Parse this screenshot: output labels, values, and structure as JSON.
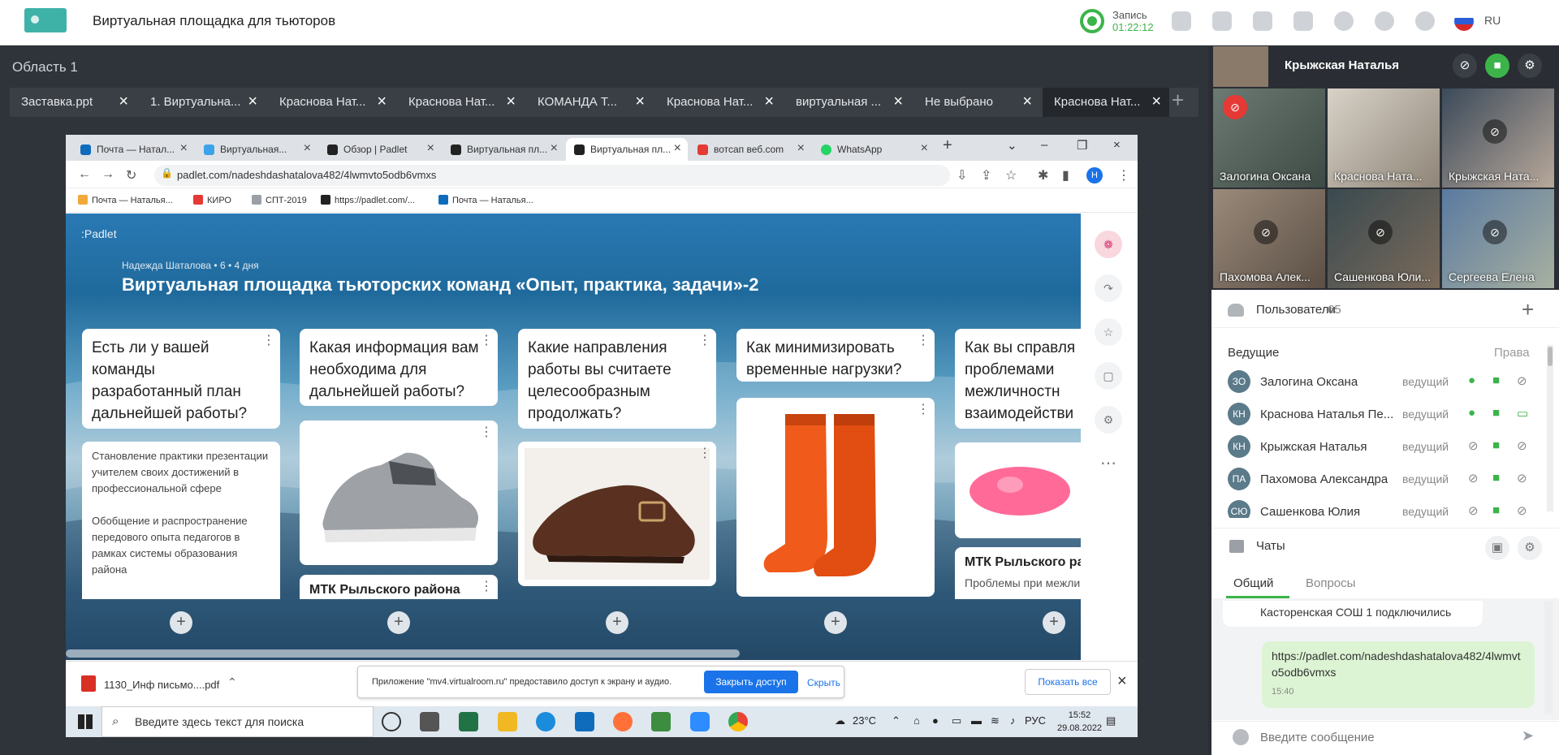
{
  "app": {
    "title": "Виртуальная площадка для тьюторов",
    "record_label": "Запись",
    "record_time": "01:22:12",
    "language": "RU"
  },
  "area_title": "Область 1",
  "doc_tabs": [
    "Заставка.ppt",
    "1. Виртуальна...",
    "Краснова Нат...",
    "Краснова Нат...",
    "КОМАНДА Т...",
    "Краснова Нат...",
    "виртуальная ...",
    "Не выбрано",
    "Краснова Нат..."
  ],
  "browser": {
    "tabs": [
      "Почта — Натал...",
      "Виртуальная...",
      "Обзор | Padlet",
      "Виртуальная пл...",
      "Виртуальная пл...",
      "вотсап веб.com",
      "WhatsApp"
    ],
    "url": "padlet.com/nadeshdashatalova482/4lwmvto5odb6vmxs",
    "bookmarks": [
      "Почта — Наталья...",
      "КИРО",
      "СПТ-2019",
      "https://padlet.com/...",
      "Почта — Наталья..."
    ],
    "profile_letter": "H"
  },
  "padlet": {
    "logo": ":Padlet",
    "meta": "Надежда Шаталова • 6 • 4 дня",
    "title": "Виртуальная площадка тьюторских команд «Опыт, практика, задачи»-2",
    "columns": [
      {
        "question": "Есть ли у вашей команды разработанный план дальнейшей работы?",
        "body": "Становление практики презентации учителем своих достижений в профессиональной сфере\n\nОбобщение и распространение передового опыта педагогов в рамках системы образования района"
      },
      {
        "question": "Какая информация вам необходима для дальнейшей работы?",
        "sub": "МТК Рыльского района"
      },
      {
        "question": "Какие направления работы вы считаете целесообразным продолжать?"
      },
      {
        "question": "Как минимизировать временные нагрузки?"
      },
      {
        "question": "Как вы справля проблемами межличностн взаимодействи",
        "sub": "МТК Рыльского ра",
        "sub_text": "Проблемы при межли"
      }
    ]
  },
  "download": {
    "file": "1130_Инф письмо....pdf",
    "share_text": "Приложение \"mv4.virtualroom.ru\" предоставило доступ к экрану и аудио.",
    "stop_label": "Закрыть доступ",
    "hide_label": "Скрыть",
    "show_all": "Показать все"
  },
  "taskbar": {
    "search_placeholder": "Введите здесь текст для поиска",
    "weather": "23°C",
    "lang": "РУС",
    "time": "15:52",
    "date": "29.08.2022"
  },
  "self_name": "Крыжская Наталья",
  "video_tiles": [
    "Залогина Оксана",
    "Краснова Ната...",
    "Крыжская Ната...",
    "Пахомова Алек...",
    "Сашенкова Юли...",
    "Сергеева Елена"
  ],
  "users": {
    "title": "Пользователи",
    "count": "65",
    "lead_label": "Ведущие",
    "rights_label": "Права",
    "list": [
      {
        "initials": "ЗО",
        "name": "Залогина Оксана",
        "role": "ведущий"
      },
      {
        "initials": "КН",
        "name": "Краснова Наталья Пе...",
        "role": "ведущий"
      },
      {
        "initials": "КН",
        "name": "Крыжская Наталья",
        "role": "ведущий"
      },
      {
        "initials": "ПА",
        "name": "Пахомова Александра",
        "role": "ведущий"
      },
      {
        "initials": "СЮ",
        "name": "Сашенкова Юлия",
        "role": "ведущий"
      }
    ]
  },
  "chat": {
    "title": "Чаты",
    "tab_general": "Общий",
    "tab_questions": "Вопросы",
    "msg1": "Касторенская СОШ 1 подключились",
    "msg2": "https://padlet.com/nadeshdashatalova482/4lwmvto5odb6vmxs",
    "msg2_time": "15:40",
    "input_placeholder": "Введите сообщение"
  }
}
